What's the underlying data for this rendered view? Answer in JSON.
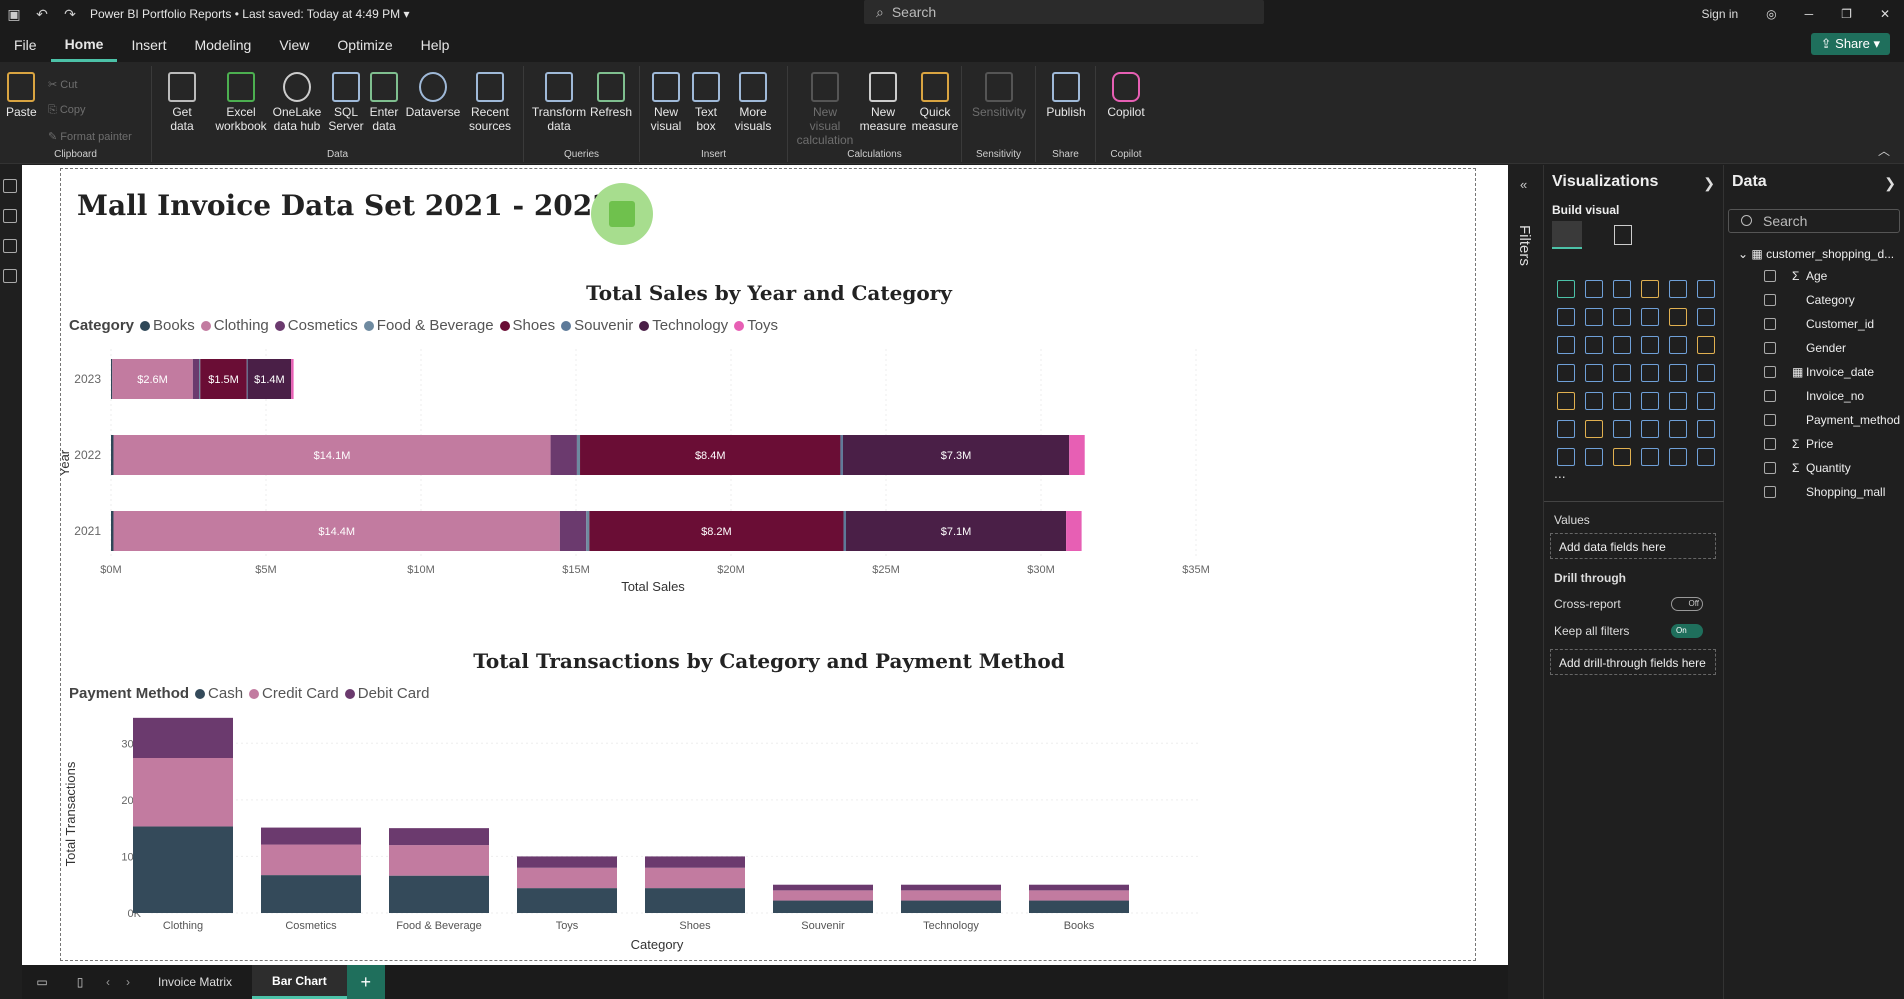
{
  "titlebar": {
    "doc_title": "Power BI Portfolio Reports",
    "saved": "Last saved: Today at 4:49 PM",
    "search_placeholder": "Search",
    "signin": "Sign in"
  },
  "menu": {
    "items": [
      "File",
      "Home",
      "Insert",
      "Modeling",
      "View",
      "Optimize",
      "Help"
    ],
    "active": "Home",
    "share": "Share"
  },
  "ribbon": {
    "clipboard": {
      "paste": "Paste",
      "cut": "Cut",
      "copy": "Copy",
      "format_painter": "Format painter",
      "label": "Clipboard"
    },
    "data": {
      "get_data": "Get data",
      "excel": "Excel workbook",
      "onelake": "OneLake data hub",
      "sql": "SQL Server",
      "enter": "Enter data",
      "dataverse": "Dataverse",
      "recent": "Recent sources",
      "label": "Data"
    },
    "queries": {
      "transform": "Transform data",
      "refresh": "Refresh",
      "label": "Queries"
    },
    "insert": {
      "new_visual": "New visual",
      "text_box": "Text box",
      "more_visuals": "More visuals",
      "label": "Insert"
    },
    "calculations": {
      "new_visual_calc": "New visual calculation",
      "new_measure": "New measure",
      "quick_measure": "Quick measure",
      "label": "Calculations"
    },
    "sensitivity": {
      "sensitivity": "Sensitivity",
      "label": "Sensitivity"
    },
    "share": {
      "publish": "Publish",
      "label": "Share"
    },
    "copilot": {
      "copilot": "Copilot",
      "label": "Copilot"
    }
  },
  "report": {
    "title": "Mall Invoice Data Set 2021 - 2023"
  },
  "chart1": {
    "title": "Total Sales by Year and Category",
    "legend_title": "Category",
    "x_title": "Total Sales",
    "y_title": "Year"
  },
  "chart2": {
    "title": "Total Transactions by Category and Payment Method",
    "legend_title": "Payment Method",
    "x_title": "Category",
    "y_title": "Total Transactions"
  },
  "chart_data": [
    {
      "type": "bar",
      "orientation": "horizontal",
      "stacked": true,
      "title": "Total Sales by Year and Category",
      "xlabel": "Total Sales",
      "ylabel": "Year",
      "categories": [
        "2023",
        "2022",
        "2021"
      ],
      "xlim": [
        0,
        35
      ],
      "x_ticks": [
        "$0M",
        "$5M",
        "$10M",
        "$15M",
        "$20M",
        "$25M",
        "$30M",
        "$35M"
      ],
      "series": [
        {
          "name": "Books",
          "color": "#2f4858",
          "values": [
            0.04,
            0.08,
            0.08
          ]
        },
        {
          "name": "Clothing",
          "color": "#c27ba0",
          "values": [
            2.6,
            14.1,
            14.4
          ],
          "labels": [
            "$2.6M",
            "$14.1M",
            "$14.4M"
          ]
        },
        {
          "name": "Cosmetics",
          "color": "#6b3a6e",
          "values": [
            0.2,
            0.85,
            0.85
          ]
        },
        {
          "name": "Food & Beverage",
          "color": "#6e8aa0",
          "values": [
            0.04,
            0.1,
            0.1
          ]
        },
        {
          "name": "Shoes",
          "color": "#6a0d35",
          "values": [
            1.5,
            8.4,
            8.2
          ],
          "labels": [
            "$1.5M",
            "$8.4M",
            "$8.2M"
          ]
        },
        {
          "name": "Souvenir",
          "color": "#5d7a99",
          "values": [
            0.03,
            0.08,
            0.08
          ]
        },
        {
          "name": "Technology",
          "color": "#4a1f47",
          "values": [
            1.4,
            7.3,
            7.1
          ],
          "labels": [
            "$1.4M",
            "$7.3M",
            "$7.1M"
          ]
        },
        {
          "name": "Toys",
          "color": "#e75fb4",
          "values": [
            0.08,
            0.5,
            0.5
          ]
        }
      ],
      "legend": "top-left"
    },
    {
      "type": "bar",
      "orientation": "vertical",
      "stacked": true,
      "title": "Total Transactions by Category and Payment Method",
      "xlabel": "Category",
      "ylabel": "Total Transactions",
      "categories": [
        "Clothing",
        "Cosmetics",
        "Food & Beverage",
        "Toys",
        "Shoes",
        "Souvenir",
        "Technology",
        "Books"
      ],
      "ylim": [
        0,
        35000
      ],
      "y_ticks": [
        "0K",
        "10K",
        "20K",
        "30K"
      ],
      "series": [
        {
          "name": "Cash",
          "color": "#344a5a",
          "values": [
            15300,
            6700,
            6600,
            4400,
            4400,
            2200,
            2200,
            2200
          ]
        },
        {
          "name": "Credit Card",
          "color": "#c27ba0",
          "values": [
            12100,
            5400,
            5400,
            3600,
            3600,
            1800,
            1800,
            1800
          ]
        },
        {
          "name": "Debit Card",
          "color": "#6b3a6e",
          "values": [
            7100,
            3000,
            3000,
            2000,
            2000,
            1000,
            1000,
            1000
          ]
        }
      ],
      "legend": "top-left"
    }
  ],
  "filters": {
    "label": "Filters"
  },
  "visualizations": {
    "title": "Visualizations",
    "build_visual": "Build visual",
    "values": "Values",
    "add_data": "Add data fields here",
    "drill_through": "Drill through",
    "cross_report": "Cross-report",
    "cross_report_state": "Off",
    "keep_filters": "Keep all filters",
    "keep_filters_state": "On",
    "add_drill": "Add drill-through fields here",
    "more": "..."
  },
  "data_pane": {
    "title": "Data",
    "search_placeholder": "Search",
    "table": "customer_shopping_d...",
    "fields": [
      {
        "name": "Age",
        "sigma": "Σ"
      },
      {
        "name": "Category",
        "sigma": ""
      },
      {
        "name": "Customer_id",
        "sigma": ""
      },
      {
        "name": "Gender",
        "sigma": ""
      },
      {
        "name": "Invoice_date",
        "sigma": "▦"
      },
      {
        "name": "Invoice_no",
        "sigma": ""
      },
      {
        "name": "Payment_method",
        "sigma": ""
      },
      {
        "name": "Price",
        "sigma": "Σ"
      },
      {
        "name": "Quantity",
        "sigma": "Σ"
      },
      {
        "name": "Shopping_mall",
        "sigma": ""
      }
    ]
  },
  "pages": {
    "tabs": [
      "Invoice Matrix",
      "Bar Chart"
    ],
    "active": "Bar Chart",
    "add": "+"
  }
}
